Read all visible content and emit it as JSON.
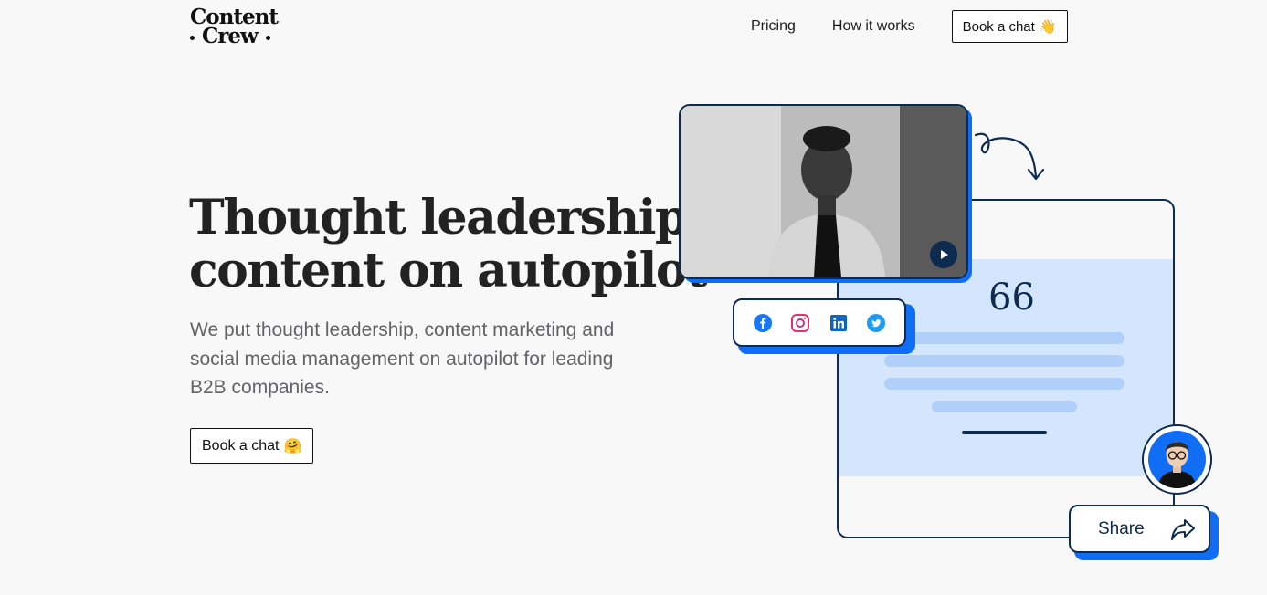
{
  "brand": {
    "logo_line1": "Content",
    "logo_line2": "Crew"
  },
  "nav": {
    "items": [
      {
        "label": "Pricing"
      },
      {
        "label": "How it works"
      }
    ],
    "book_label": "Book a chat",
    "book_emoji": "👋"
  },
  "hero": {
    "title_line1": "Thought leadership",
    "title_line2": "content on autopilot",
    "subtitle": "We put thought leadership, content marketing and social media management on autopilot for leading B2B companies.",
    "cta_label": "Book a chat",
    "cta_emoji": "🤗"
  },
  "illustration": {
    "quote_mark": "66",
    "share_label": "Share",
    "social_icons": [
      "facebook-icon",
      "instagram-icon",
      "linkedin-icon",
      "twitter-icon"
    ],
    "colors": {
      "navy": "#0d2a4f",
      "blue": "#0f6ef5",
      "light_blue": "#d4e6fd",
      "bar_blue": "#b0cff9"
    }
  }
}
